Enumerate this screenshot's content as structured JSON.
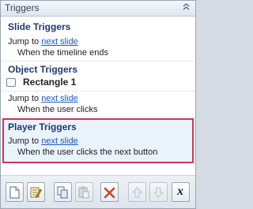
{
  "panel": {
    "title": "Triggers",
    "collapse_icon": "chevron-up-icon"
  },
  "sections": {
    "slide": {
      "title": "Slide Triggers",
      "action_prefix": "Jump to",
      "action_link": "next slide",
      "condition": "When the timeline ends"
    },
    "object": {
      "title": "Object Triggers",
      "object_name": "Rectangle 1",
      "action_prefix": "Jump to",
      "action_link": "next slide",
      "condition": "When the user clicks"
    },
    "player": {
      "title": "Player Triggers",
      "action_prefix": "Jump to",
      "action_link": "next slide",
      "condition": "When the user clicks the next button"
    }
  },
  "toolbar": {
    "buttons": [
      {
        "name": "new-trigger-icon"
      },
      {
        "name": "edit-trigger-icon"
      },
      {
        "name": "copy-icon"
      },
      {
        "name": "paste-icon"
      },
      {
        "name": "delete-icon"
      },
      {
        "name": "move-up-icon"
      },
      {
        "name": "move-down-icon"
      },
      {
        "name": "variables-icon",
        "label": "x"
      }
    ]
  },
  "colors": {
    "link": "#1a56c4",
    "section_title": "#1e3a6e",
    "selection_border": "#d2345b",
    "selection_bg": "#eaf2fb"
  }
}
